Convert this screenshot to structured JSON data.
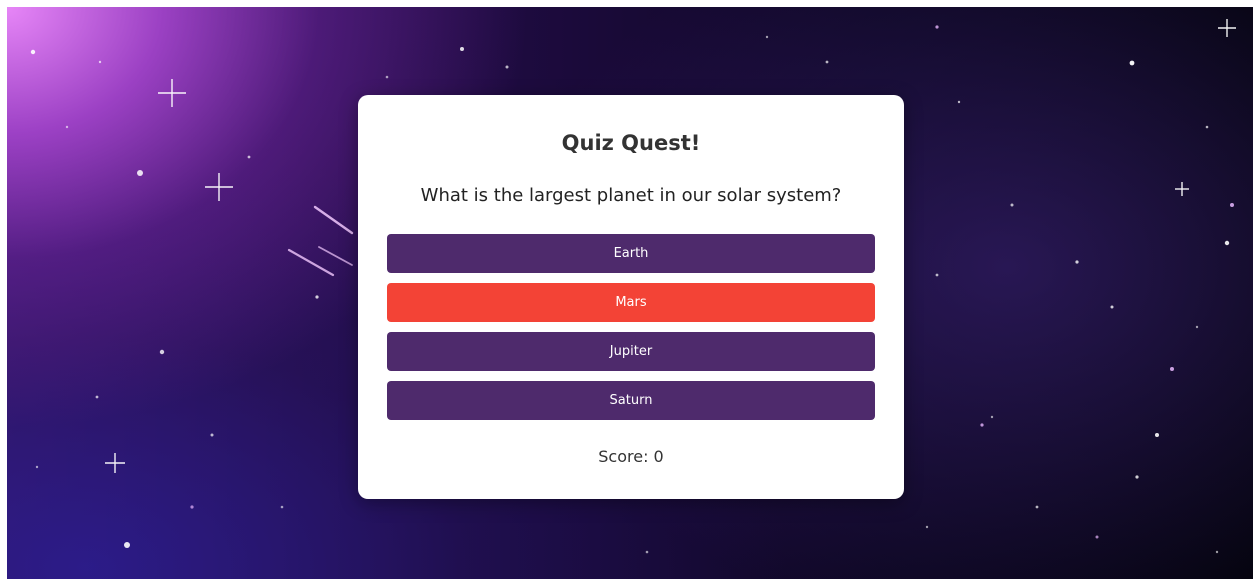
{
  "quiz": {
    "title": "Quiz Quest!",
    "question": "What is the largest planet in our solar system?",
    "options": [
      {
        "label": "Earth",
        "state": "default"
      },
      {
        "label": "Mars",
        "state": "selected-wrong"
      },
      {
        "label": "Jupiter",
        "state": "default"
      },
      {
        "label": "Saturn",
        "state": "default"
      }
    ],
    "score_text": "Score: 0"
  },
  "colors": {
    "option_default": "#4e2a6c",
    "option_wrong": "#f34336",
    "card_background": "#ffffff"
  }
}
